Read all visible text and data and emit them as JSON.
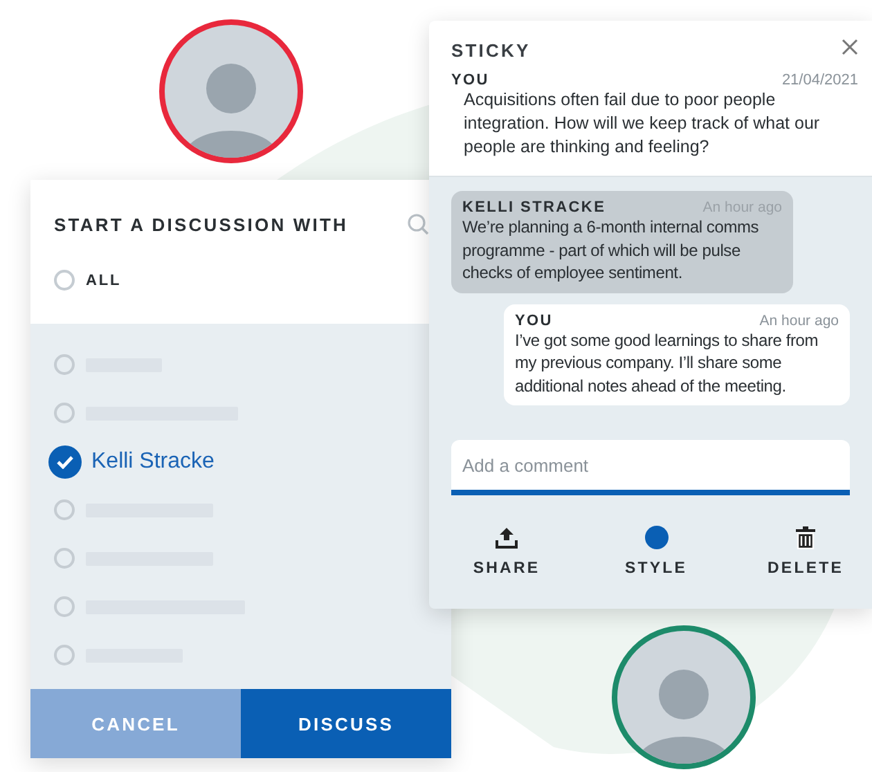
{
  "discussion": {
    "title": "START A DISCUSSION WITH",
    "all_option": {
      "label": "ALL",
      "selected": false
    },
    "people": [
      {
        "kind": "placeholder",
        "selected": false
      },
      {
        "kind": "placeholder",
        "selected": false
      },
      {
        "kind": "person",
        "label": "Kelli Stracke",
        "selected": true
      },
      {
        "kind": "placeholder",
        "selected": false
      },
      {
        "kind": "placeholder",
        "selected": false
      },
      {
        "kind": "placeholder",
        "selected": false
      },
      {
        "kind": "placeholder",
        "selected": false
      }
    ],
    "buttons": [
      {
        "label": "CANCEL",
        "kind": "secondary"
      },
      {
        "label": "DISCUSS",
        "kind": "primary"
      }
    ]
  },
  "sticky": {
    "title": "STICKY",
    "post": {
      "author": "YOU",
      "date": "21/04/2021",
      "text": "Acquisitions often fail due to poor people integration. How will we keep track of what our people are thinking and feeling?"
    },
    "comments": [
      {
        "kind": "received",
        "author": "KELLI STRACKE",
        "time": "An hour ago",
        "text": "We’re planning a 6-month internal comms programme - part of which will be pulse checks of employee sentiment."
      },
      {
        "kind": "sent",
        "author": "YOU",
        "time": "An hour ago",
        "text": "I’ve got some good learnings to share from my previous company. I’ll share some additional notes ahead of the meeting."
      }
    ],
    "comment_field": {
      "placeholder": "Add a comment"
    },
    "actions": [
      {
        "kind": "share",
        "label": "SHARE"
      },
      {
        "kind": "style",
        "label": "STYLE"
      },
      {
        "kind": "delete",
        "label": "DELETE"
      }
    ]
  }
}
